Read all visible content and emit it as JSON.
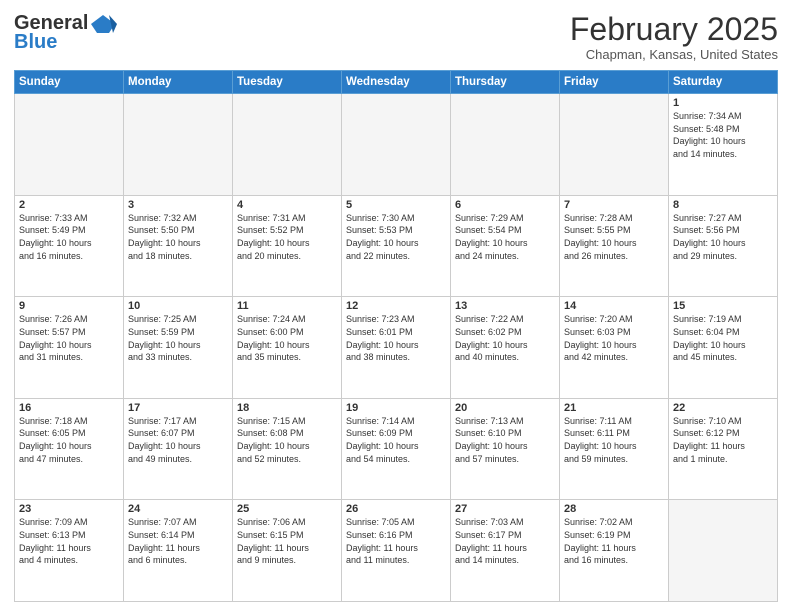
{
  "header": {
    "logo_general": "General",
    "logo_blue": "Blue",
    "month": "February 2025",
    "location": "Chapman, Kansas, United States"
  },
  "days_of_week": [
    "Sunday",
    "Monday",
    "Tuesday",
    "Wednesday",
    "Thursday",
    "Friday",
    "Saturday"
  ],
  "weeks": [
    [
      {
        "day": "",
        "info": ""
      },
      {
        "day": "",
        "info": ""
      },
      {
        "day": "",
        "info": ""
      },
      {
        "day": "",
        "info": ""
      },
      {
        "day": "",
        "info": ""
      },
      {
        "day": "",
        "info": ""
      },
      {
        "day": "1",
        "info": "Sunrise: 7:34 AM\nSunset: 5:48 PM\nDaylight: 10 hours\nand 14 minutes."
      }
    ],
    [
      {
        "day": "2",
        "info": "Sunrise: 7:33 AM\nSunset: 5:49 PM\nDaylight: 10 hours\nand 16 minutes."
      },
      {
        "day": "3",
        "info": "Sunrise: 7:32 AM\nSunset: 5:50 PM\nDaylight: 10 hours\nand 18 minutes."
      },
      {
        "day": "4",
        "info": "Sunrise: 7:31 AM\nSunset: 5:52 PM\nDaylight: 10 hours\nand 20 minutes."
      },
      {
        "day": "5",
        "info": "Sunrise: 7:30 AM\nSunset: 5:53 PM\nDaylight: 10 hours\nand 22 minutes."
      },
      {
        "day": "6",
        "info": "Sunrise: 7:29 AM\nSunset: 5:54 PM\nDaylight: 10 hours\nand 24 minutes."
      },
      {
        "day": "7",
        "info": "Sunrise: 7:28 AM\nSunset: 5:55 PM\nDaylight: 10 hours\nand 26 minutes."
      },
      {
        "day": "8",
        "info": "Sunrise: 7:27 AM\nSunset: 5:56 PM\nDaylight: 10 hours\nand 29 minutes."
      }
    ],
    [
      {
        "day": "9",
        "info": "Sunrise: 7:26 AM\nSunset: 5:57 PM\nDaylight: 10 hours\nand 31 minutes."
      },
      {
        "day": "10",
        "info": "Sunrise: 7:25 AM\nSunset: 5:59 PM\nDaylight: 10 hours\nand 33 minutes."
      },
      {
        "day": "11",
        "info": "Sunrise: 7:24 AM\nSunset: 6:00 PM\nDaylight: 10 hours\nand 35 minutes."
      },
      {
        "day": "12",
        "info": "Sunrise: 7:23 AM\nSunset: 6:01 PM\nDaylight: 10 hours\nand 38 minutes."
      },
      {
        "day": "13",
        "info": "Sunrise: 7:22 AM\nSunset: 6:02 PM\nDaylight: 10 hours\nand 40 minutes."
      },
      {
        "day": "14",
        "info": "Sunrise: 7:20 AM\nSunset: 6:03 PM\nDaylight: 10 hours\nand 42 minutes."
      },
      {
        "day": "15",
        "info": "Sunrise: 7:19 AM\nSunset: 6:04 PM\nDaylight: 10 hours\nand 45 minutes."
      }
    ],
    [
      {
        "day": "16",
        "info": "Sunrise: 7:18 AM\nSunset: 6:05 PM\nDaylight: 10 hours\nand 47 minutes."
      },
      {
        "day": "17",
        "info": "Sunrise: 7:17 AM\nSunset: 6:07 PM\nDaylight: 10 hours\nand 49 minutes."
      },
      {
        "day": "18",
        "info": "Sunrise: 7:15 AM\nSunset: 6:08 PM\nDaylight: 10 hours\nand 52 minutes."
      },
      {
        "day": "19",
        "info": "Sunrise: 7:14 AM\nSunset: 6:09 PM\nDaylight: 10 hours\nand 54 minutes."
      },
      {
        "day": "20",
        "info": "Sunrise: 7:13 AM\nSunset: 6:10 PM\nDaylight: 10 hours\nand 57 minutes."
      },
      {
        "day": "21",
        "info": "Sunrise: 7:11 AM\nSunset: 6:11 PM\nDaylight: 10 hours\nand 59 minutes."
      },
      {
        "day": "22",
        "info": "Sunrise: 7:10 AM\nSunset: 6:12 PM\nDaylight: 11 hours\nand 1 minute."
      }
    ],
    [
      {
        "day": "23",
        "info": "Sunrise: 7:09 AM\nSunset: 6:13 PM\nDaylight: 11 hours\nand 4 minutes."
      },
      {
        "day": "24",
        "info": "Sunrise: 7:07 AM\nSunset: 6:14 PM\nDaylight: 11 hours\nand 6 minutes."
      },
      {
        "day": "25",
        "info": "Sunrise: 7:06 AM\nSunset: 6:15 PM\nDaylight: 11 hours\nand 9 minutes."
      },
      {
        "day": "26",
        "info": "Sunrise: 7:05 AM\nSunset: 6:16 PM\nDaylight: 11 hours\nand 11 minutes."
      },
      {
        "day": "27",
        "info": "Sunrise: 7:03 AM\nSunset: 6:17 PM\nDaylight: 11 hours\nand 14 minutes."
      },
      {
        "day": "28",
        "info": "Sunrise: 7:02 AM\nSunset: 6:19 PM\nDaylight: 11 hours\nand 16 minutes."
      },
      {
        "day": "",
        "info": ""
      }
    ]
  ]
}
